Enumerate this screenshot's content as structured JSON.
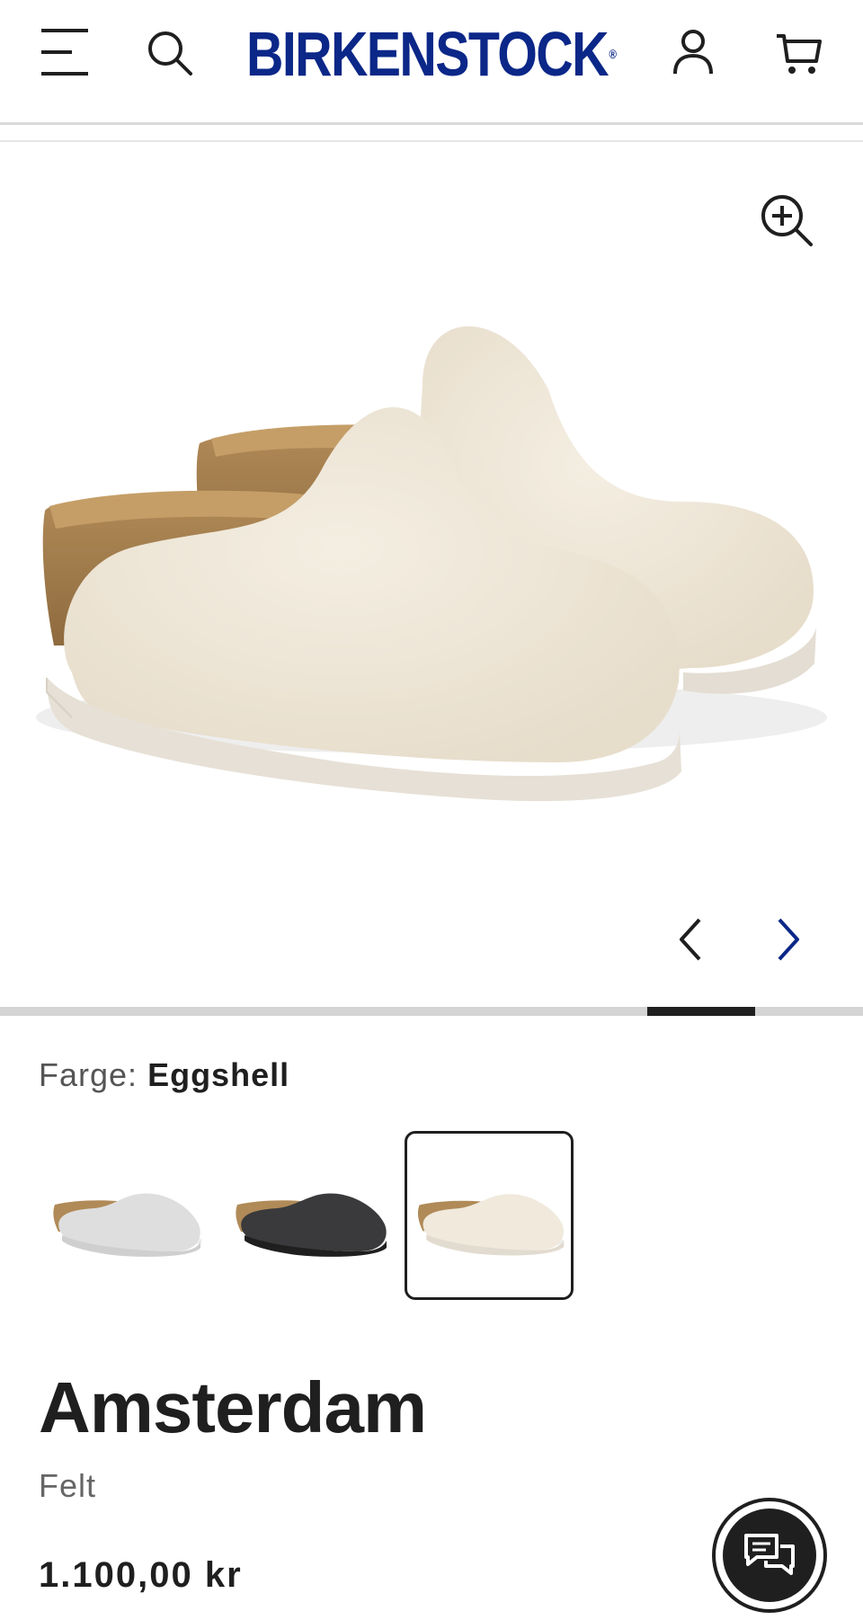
{
  "header": {
    "logo": "BIRKENSTOCK",
    "logo_mark": "®",
    "icons": [
      "menu-icon",
      "search-icon",
      "account-icon",
      "cart-icon"
    ]
  },
  "gallery": {
    "product_image": "Amsterdam felt clog pair, eggshell",
    "progress": 0.125,
    "icons": [
      "zoom-in-icon",
      "chevron-left-icon",
      "chevron-right-icon"
    ]
  },
  "color": {
    "label": "Farge:",
    "value": "Eggshell",
    "swatches": [
      {
        "name": "light-gray",
        "selected": false
      },
      {
        "name": "anthracite",
        "selected": false
      },
      {
        "name": "eggshell",
        "selected": true
      }
    ]
  },
  "product": {
    "name": "Amsterdam",
    "material": "Felt",
    "price": "1.100,00 kr"
  },
  "chat": {
    "icon": "chat-bubbles-icon"
  },
  "colors": {
    "brand": "#0b2788",
    "text": "#1f1f1f",
    "muted": "#666666",
    "nav_next": "#0b2788"
  }
}
